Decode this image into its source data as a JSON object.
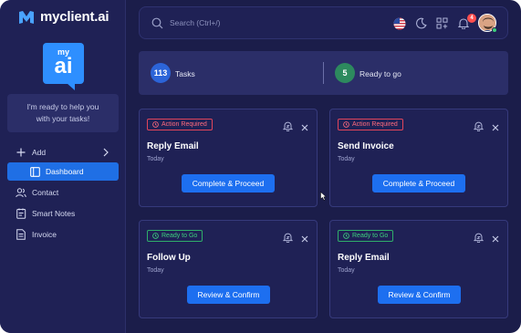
{
  "brand": {
    "name": "myclient.ai",
    "badge_top": "my",
    "badge_main": "ai"
  },
  "assistant": {
    "message_line1": "I'm ready to help you",
    "message_line2": "with your tasks!"
  },
  "sidebar": {
    "items": [
      {
        "label": "Add",
        "icon": "plus-icon"
      },
      {
        "label": "Dashboard",
        "icon": "dashboard-icon",
        "active": true
      },
      {
        "label": "Contact",
        "icon": "users-icon"
      },
      {
        "label": "Smart Notes",
        "icon": "notes-icon"
      },
      {
        "label": "Invoice",
        "icon": "invoice-icon"
      }
    ]
  },
  "topbar": {
    "search_placeholder": "Search (Ctrl+/)",
    "notification_count": "4",
    "icons": [
      "us-flag-icon",
      "moon-icon",
      "apps-grid-icon",
      "bell-icon",
      "avatar"
    ]
  },
  "stats": [
    {
      "value": "113",
      "label": "Tasks",
      "color": "#2c64d8"
    },
    {
      "value": "5",
      "label": "Ready to go",
      "color": "#2d8a5e"
    }
  ],
  "cards": [
    {
      "status": "Action Required",
      "status_type": "red",
      "title": "Reply Email",
      "date": "Today",
      "button": "Complete & Proceed"
    },
    {
      "status": "Action Required",
      "status_type": "red",
      "title": "Send Invoice",
      "date": "Today",
      "button": "Complete & Proceed"
    },
    {
      "status": "Ready to Go",
      "status_type": "green",
      "title": "Follow Up",
      "date": "Today",
      "button": "Review & Confirm"
    },
    {
      "status": "Ready to Go",
      "status_type": "green",
      "title": "Reply Email",
      "date": "Today",
      "button": "Review & Confirm"
    }
  ],
  "colors": {
    "background": "#1b1d4a",
    "panel": "#1f2155",
    "accent": "#1d6ff0",
    "danger": "#e0455b",
    "success": "#2fae6a"
  }
}
